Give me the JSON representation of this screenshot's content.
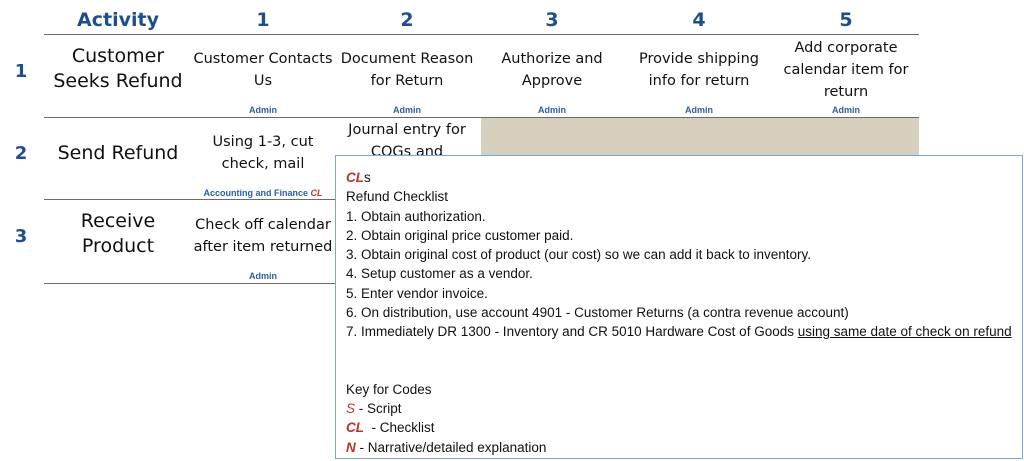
{
  "header": {
    "activity": "Activity",
    "steps": [
      "1",
      "2",
      "3",
      "4",
      "5"
    ]
  },
  "rows": [
    {
      "num": "1",
      "activity": "Customer Seeks Refund",
      "cells": [
        {
          "text": "Customer Contacts Us",
          "role": "Admin"
        },
        {
          "text": "Document Reason for Return",
          "role": "Admin"
        },
        {
          "text": "Authorize and Approve",
          "role": "Admin"
        },
        {
          "text": "Provide shipping info for return",
          "role": "Admin"
        },
        {
          "text": "Add corporate calendar item for return",
          "role": "Admin"
        }
      ]
    },
    {
      "num": "2",
      "activity": "Send Refund",
      "cells": [
        {
          "text": "Using 1-3, cut check, mail",
          "role": "Accounting and Finance",
          "role_code": "CL"
        },
        {
          "text": "Journal entry for COGs and"
        }
      ]
    },
    {
      "num": "3",
      "activity": "Receive Product",
      "cells": [
        {
          "text": "Check off calendar after item returned",
          "role": "Admin"
        }
      ]
    }
  ],
  "popup": {
    "title_code": "CL",
    "title_suffix": "s",
    "heading": "Refund Checklist",
    "items": [
      "1. Obtain authorization.",
      "2. Obtain original price customer paid.",
      "3. Obtain original cost of product (our cost) so we can add it back to inventory.",
      "4. Setup customer as a vendor.",
      "5. Enter vendor invoice.",
      "6. On distribution, use account 4901 - Customer Returns (a contra revenue account)"
    ],
    "item7_text": "7. Immediately DR 1300 - Inventory and CR 5010 Hardware Cost of Goods ",
    "item7_underlined": "using same date of check on refund",
    "key_heading": "Key for Codes",
    "key": [
      {
        "code": "S",
        "desc": " - Script"
      },
      {
        "code": "CL",
        "desc": "  - Checklist"
      },
      {
        "code": "N",
        "desc": " - Narrative/detailed explanation"
      }
    ]
  },
  "colors": {
    "header_blue": "#1f4e8c",
    "role_blue": "#2e5e9e",
    "code_red": "#b5332a",
    "shade": "#d7cfbe",
    "popup_border": "#7fa6d3"
  }
}
